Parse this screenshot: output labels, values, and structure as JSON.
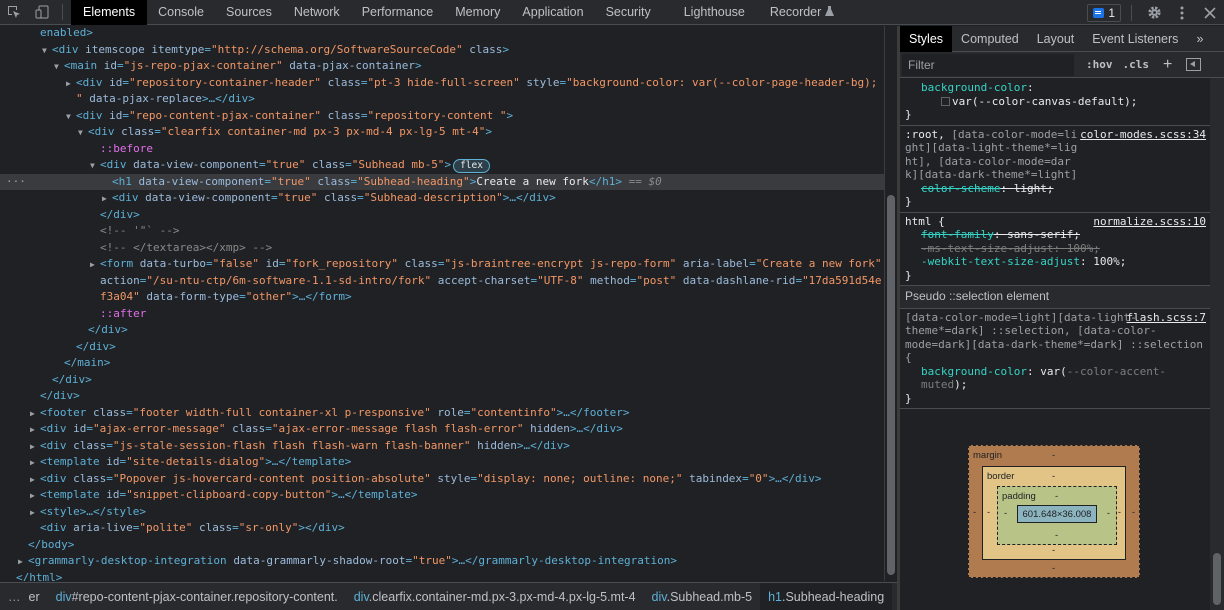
{
  "toolbar": {
    "inspect_icon": "inspect-element-icon",
    "device_icon": "device-toolbar-icon",
    "tabs": [
      {
        "label": "Elements",
        "active": true
      },
      {
        "label": "Console"
      },
      {
        "label": "Sources"
      },
      {
        "label": "Network"
      },
      {
        "label": "Performance"
      },
      {
        "label": "Memory"
      },
      {
        "label": "Application"
      },
      {
        "label": "Security"
      },
      {
        "label": "Lighthouse"
      },
      {
        "label": "Recorder"
      }
    ],
    "recorder_icon": "flask-icon",
    "issues_count": "1",
    "settings_icon": "gear-icon",
    "more_icon": "kebab-icon",
    "close_icon": "close-icon"
  },
  "dom": {
    "l0": "enabled>",
    "l1": {
      "tag_open": "<div ",
      "a1": "itemscope ",
      "a2": "itemtype",
      "v2": "\"http://schema.org/SoftwareSourceCode\"",
      "a3": " class",
      "close": ">"
    },
    "l2": {
      "tag_open": "<main ",
      "a1": "id",
      "v1": "\"js-repo-pjax-container\"",
      "a2": " data-pjax-container",
      "close": ">"
    },
    "l3": {
      "tag_open": "<div ",
      "a1": "id",
      "v1": "\"repository-container-header\"",
      "a2": " class",
      "v2": "\"pt-3 hide-full-screen\"",
      "a3": " style",
      "v3": "\"background-color: var(--color-page-header-bg);"
    },
    "l4": {
      "v": "\"",
      "a": " data-pjax-replace",
      "close": ">…</div>"
    },
    "l5": {
      "tag_open": "<div ",
      "a1": "id",
      "v1": "\"repo-content-pjax-container\"",
      "a2": " class",
      "v2": "\"repository-content \"",
      "close": ">"
    },
    "l6": {
      "tag_open": "<div ",
      "a1": "class",
      "v1": "\"clearfix container-md px-3 px-md-4 px-lg-5 mt-4\"",
      "close": ">"
    },
    "l7": "::before",
    "l8": {
      "tag_open": "<div ",
      "a1": "data-view-component",
      "v1": "\"true\"",
      "a2": " class",
      "v2": "\"Subhead mb-5\"",
      "close": ">",
      "badge": "flex"
    },
    "l9": {
      "tag_open": "<h1 ",
      "a1": "data-view-component",
      "v1": "\"true\"",
      "a2": " class",
      "v2": "\"Subhead-heading\"",
      "close": ">",
      "text": "Create a new fork",
      "end": "</h1>",
      "eq": " == ",
      "ref": "$0"
    },
    "l10": {
      "tag_open": "<div ",
      "a1": "data-view-component",
      "v1": "\"true\"",
      "a2": " class",
      "v2": "\"Subhead-description\"",
      "close": ">…</div>"
    },
    "l11": "</div>",
    "l12": "<!-- '\"` -->",
    "l13": "<!-- </textarea></xmp> -->",
    "l14": {
      "tag_open": "<form ",
      "a1": "data-turbo",
      "v1": "\"false\"",
      "a2": " id",
      "v2": "\"fork_repository\"",
      "a3": " class",
      "v3": "\"js-braintree-encrypt js-repo-form\"",
      "a4": " aria-label",
      "v4": "\"Create a new fork\""
    },
    "l15": {
      "a1": "action",
      "v1": "\"/su-ntu-ctp/6m-software-1.1-sd-intro/fork\"",
      "a2": " accept-charset",
      "v2": "\"UTF-8\"",
      "a3": " method",
      "v3": "\"post\"",
      "a4": " data-dashlane-rid",
      "v4": "\"17da591d54e"
    },
    "l16": {
      "v": "f3a04\"",
      "a": " data-form-type",
      "v2": "\"other\"",
      "close": ">…</form>"
    },
    "l17": "::after",
    "l18": "</div>",
    "l19": "</div>",
    "l20": "</main>",
    "l21": "</div>",
    "l22": "</div>",
    "l23": {
      "tag_open": "<footer ",
      "a1": "class",
      "v1": "\"footer width-full container-xl p-responsive\"",
      "a2": " role",
      "v2": "\"contentinfo\"",
      "close": ">…</footer>"
    },
    "l24": {
      "tag_open": "<div ",
      "a1": "id",
      "v1": "\"ajax-error-message\"",
      "a2": " class",
      "v2": "\"ajax-error-message flash flash-error\"",
      "a3": " hidden",
      "close": ">…</div>"
    },
    "l25": {
      "tag_open": "<div ",
      "a1": "class",
      "v1": "\"js-stale-session-flash flash flash-warn flash-banner\"",
      "a2": " hidden",
      "close": ">…</div>"
    },
    "l26": {
      "tag_open": "<template ",
      "a1": "id",
      "v1": "\"site-details-dialog\"",
      "close": ">…</template>"
    },
    "l27": {
      "tag_open": "<div ",
      "a1": "class",
      "v1": "\"Popover js-hovercard-content position-absolute\"",
      "a2": " style",
      "v2": "\"display: none; outline: none;\"",
      "a3": " tabindex",
      "v3": "\"0\"",
      "close": ">…</div>"
    },
    "l28": {
      "tag_open": "<template ",
      "a1": "id",
      "v1": "\"snippet-clipboard-copy-button\"",
      "close": ">…</template>"
    },
    "l29": {
      "tag_open": "<style>",
      "close": "…</style>"
    },
    "l30": {
      "tag_open": "<div ",
      "a1": "aria-live",
      "v1": "\"polite\"",
      "a2": " class",
      "v2": "\"sr-only\"",
      "close": "></div>"
    },
    "l31": "</body>",
    "l32": {
      "tag_open": "<grammarly-desktop-integration ",
      "a1": "data-grammarly-shadow-root",
      "v1": "\"true\"",
      "close": ">…</grammarly-desktop-integration>"
    },
    "l33": "</html>"
  },
  "breadcrumbs": {
    "more_left": "…",
    "items": [
      {
        "tag": "",
        "rest": "er"
      },
      {
        "tag": "div",
        "rest": "#repo-content-pjax-container.repository-content."
      },
      {
        "tag": "div",
        "rest": ".clearfix.container-md.px-3.px-md-4.px-lg-5.mt-4"
      },
      {
        "tag": "div",
        "rest": ".Subhead.mb-5"
      },
      {
        "tag": "h1",
        "rest": ".Subhead-heading",
        "active": true
      }
    ],
    "more_right": "…"
  },
  "styles_panel": {
    "tabs": [
      {
        "label": "Styles",
        "active": true
      },
      {
        "label": "Computed"
      },
      {
        "label": "Layout"
      },
      {
        "label": "Event Listeners"
      },
      {
        "label": "»"
      }
    ],
    "filter_placeholder": "Filter",
    "hov": ":hov",
    "cls": ".cls",
    "plus": "+",
    "rules": [
      {
        "prop_name": "background-color",
        "prop_value": "var(--color-canvas-default);"
      },
      {
        "selector_main": ":root,",
        "selector_rest": " [data-color-mode=light][data-light-theme*=light], [data-color-mode=dark][data-dark-theme*=light]",
        "source": "color-modes.scss:34",
        "prop_name": "color-scheme",
        "prop_value": "light;"
      },
      {
        "selector": "html {",
        "source": "normalize.scss:10",
        "props": [
          {
            "name": "font-family",
            "value": "sans-serif;",
            "struck": true
          },
          {
            "name": "-ms-text-size-adjust",
            "value": "100%;",
            "struck": true,
            "dim": true
          },
          {
            "name": "-webkit-text-size-adjust",
            "value": "100%;"
          }
        ]
      }
    ],
    "pseudo_header": "Pseudo ::selection element",
    "pseudo_rule": {
      "selector": "[data-color-mode=light][data-light-theme*=dark] ::selection, [data-color-mode=dark][data-dark-theme*=dark] ::selection {",
      "source": "flash.scss:7",
      "prop_name": "background-color",
      "prop_value_prefix": "var(",
      "prop_value_var": "--color-accent-muted",
      "prop_value_suffix": ");"
    },
    "close_brace": "}",
    "box_model": {
      "margin_label": "margin",
      "border_label": "border",
      "padding_label": "padding",
      "dash": "-",
      "content_size": "601.648×36.008"
    }
  }
}
